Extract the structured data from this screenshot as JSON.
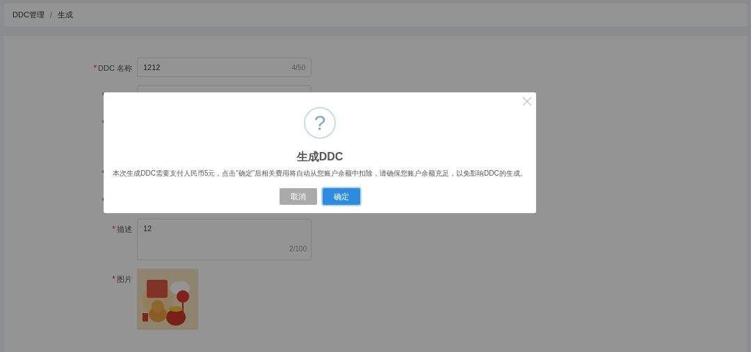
{
  "breadcrumb": {
    "separator": "/",
    "items": [
      {
        "label": "DDC管理"
      },
      {
        "label": "生成"
      }
    ]
  },
  "form": {
    "fields": [
      {
        "kind": "input",
        "required_mark": "*",
        "label": "DDC 名称",
        "value": "1212",
        "counter": "4/50"
      },
      {
        "kind": "covered",
        "required_mark": "*"
      },
      {
        "kind": "covered",
        "required_mark": "*"
      },
      {
        "kind": "covered",
        "required_mark": "*"
      },
      {
        "kind": "covered",
        "required_mark": "*"
      },
      {
        "kind": "textarea",
        "required_mark": "*",
        "label": "描述",
        "value": "12",
        "counter": "2/100"
      },
      {
        "required_mark": "*",
        "label": "图片"
      }
    ]
  },
  "dialog": {
    "title": "生成DDC",
    "icon": "?",
    "message": "本次生成DDC需要支付人民币5元，点击“确定”后相关费用将自动从您账户余额中扣除，请确保您账户余额充足，以免影响DDC的生成。",
    "buttons": [
      {
        "label": "取消",
        "kind": "secondary"
      },
      {
        "label": "确定",
        "kind": "primary"
      }
    ]
  }
}
